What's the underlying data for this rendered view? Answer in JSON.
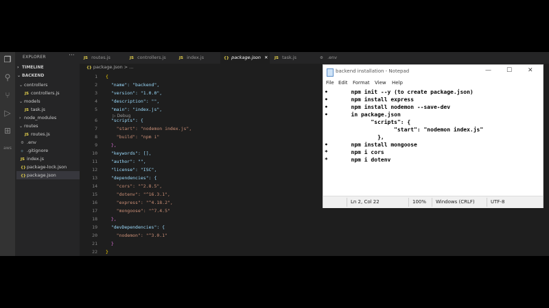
{
  "explorer": {
    "title": "EXPLORER",
    "more": "···",
    "timeline": "TIMELINE",
    "root": "BACKEND",
    "items": [
      {
        "label": "controllers",
        "icon": "chevron-down",
        "kind": "folder"
      },
      {
        "label": "controllers.js",
        "icon": "JS",
        "kind": "file"
      },
      {
        "label": "models",
        "icon": "chevron-down",
        "kind": "folder"
      },
      {
        "label": "task.js",
        "icon": "JS",
        "kind": "file"
      },
      {
        "label": "node_modules",
        "icon": "chevron-right",
        "kind": "folder"
      },
      {
        "label": "routes",
        "icon": "chevron-down",
        "kind": "folder"
      },
      {
        "label": "routes.js",
        "icon": "JS",
        "kind": "file"
      },
      {
        "label": ".env",
        "icon": "gear",
        "kind": "file"
      },
      {
        "label": ".gitignore",
        "icon": "diamond",
        "kind": "file"
      },
      {
        "label": "index.js",
        "icon": "JS",
        "kind": "file"
      },
      {
        "label": "package-lock.json",
        "icon": "{}",
        "kind": "file"
      },
      {
        "label": "package.json",
        "icon": "{}",
        "kind": "file",
        "selected": true
      }
    ]
  },
  "tabs": [
    {
      "label": "routes.js",
      "icon": "JS"
    },
    {
      "label": "controllers.js",
      "icon": "JS"
    },
    {
      "label": "index.js",
      "icon": "JS"
    },
    {
      "label": "package.json",
      "icon": "{}",
      "active": true,
      "close": "✕"
    },
    {
      "label": "task.js",
      "icon": "JS"
    },
    {
      "label": ".env",
      "icon": "gear"
    }
  ],
  "breadcrumb": {
    "file": "package.json",
    "rest": "> ..."
  },
  "codelens": "▷ Debug",
  "code_lines": [
    "{",
    "  \"name\": \"backend\",",
    "  \"version\": \"1.0.0\",",
    "  \"description\": \"\",",
    "  \"main\": \"index.js\",",
    "  \"scripts\": {",
    "    \"start\": \"nodemon index.js\",",
    "    \"build\": \"npm i\"",
    "  },",
    "  \"keywords\": [],",
    "  \"author\": \"\",",
    "  \"license\": \"ISC\",",
    "  \"dependencies\": {",
    "    \"cors\": \"^2.8.5\",",
    "    \"dotenv\": \"^16.3.1\",",
    "    \"express\": \"^4.18.2\",",
    "    \"mongoose\": \"^7.4.5\"",
    "  },",
    "  \"devDependencies\": {",
    "    \"nodemon\": \"^3.0.1\"",
    "  }",
    "}"
  ],
  "notepad": {
    "title": "backend installation - Notepad",
    "controls": {
      "minimize": "—",
      "maximize": "☐",
      "close": "✕"
    },
    "menu": [
      "File",
      "Edit",
      "Format",
      "View",
      "Help"
    ],
    "lines": [
      "•       npm init --y (to create package.json)",
      "•       npm install express",
      "•       npm install nodemon --save-dev",
      "•       in package.json",
      "              \"scripts\": {",
      "                     \"start\": \"nodemon index.js\"",
      "                },",
      "•       npm install mongoose",
      "*       npm i cors",
      "*       npm i dotenv"
    ],
    "status": {
      "position": "Ln 2, Col 22",
      "zoom": "100%",
      "eol": "Windows (CRLF)",
      "encoding": "UTF-8"
    }
  },
  "colors": {
    "vscode_bg": "#1e1e1e",
    "sidebar_bg": "#252526",
    "activity_bg": "#333333",
    "notepad_bg": "#ffffff"
  }
}
